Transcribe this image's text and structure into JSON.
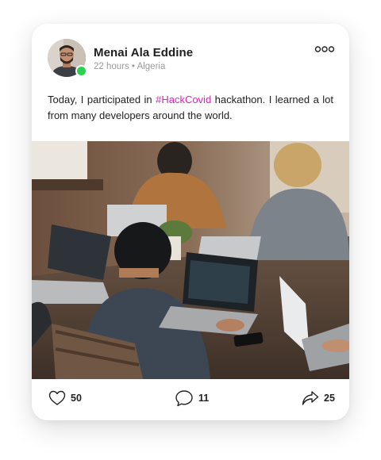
{
  "post": {
    "author": {
      "name": "Menai Ala Eddine",
      "time": "22 hours",
      "location": "Algeria",
      "online": true
    },
    "text_before": "Today, I participated in ",
    "hashtag": "#HackCovid",
    "text_after": " hackathon. I learned a lot from many developers around the world.",
    "photo": {
      "description_icon": "photo-of-developers-at-table"
    }
  },
  "actions": {
    "likes": "50",
    "comments": "11",
    "shares": "25"
  },
  "colors": {
    "accent": "#e21ec3",
    "online": "#2ad34f"
  }
}
